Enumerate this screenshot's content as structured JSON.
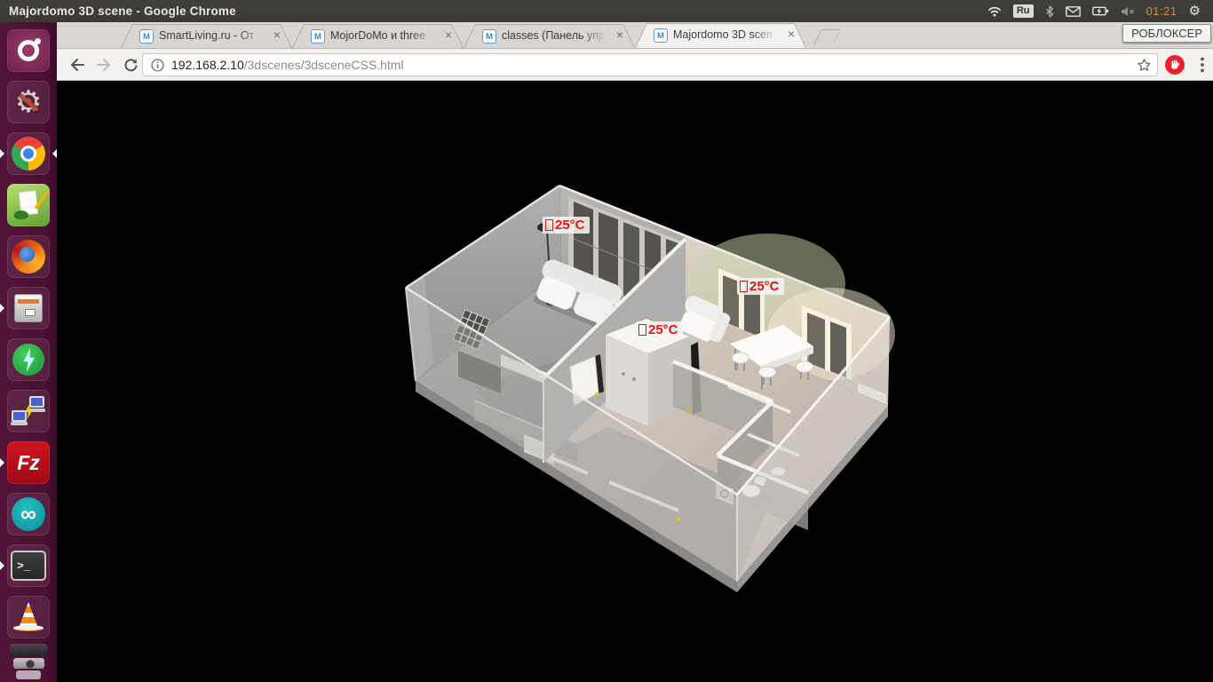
{
  "panel": {
    "window_title": "Majordomo 3D scene - Google Chrome",
    "keyboard_layout": "Ru",
    "clock": "01:21",
    "overlay_badge": "РОБЛОКСЕР",
    "tray_icons": [
      "wifi-icon",
      "keyboard-layout-indicator",
      "bluetooth-icon",
      "mail-icon",
      "battery-charging-icon",
      "volume-muted-icon",
      "clock",
      "session-gear-icon"
    ]
  },
  "launcher": {
    "items": [
      {
        "name": "ubuntu-dash"
      },
      {
        "name": "system-settings"
      },
      {
        "name": "google-chrome",
        "running": true,
        "focused": true
      },
      {
        "name": "notepad-editor"
      },
      {
        "name": "firefox"
      },
      {
        "name": "file-archiver",
        "running": true
      },
      {
        "name": "lightning-app"
      },
      {
        "name": "remote-connection-app"
      },
      {
        "name": "filezilla",
        "glyph": "Fz",
        "running": true
      },
      {
        "name": "arduino-ide",
        "glyph": "∞"
      },
      {
        "name": "terminal",
        "glyph": ">_",
        "running": true
      },
      {
        "name": "vlc"
      },
      {
        "name": "folded-phone-app"
      },
      {
        "name": "folded-camera-app"
      },
      {
        "name": "folded-paper-app"
      }
    ]
  },
  "browser": {
    "close_glyph": "×",
    "tabs": [
      {
        "title": "SmartLiving.ru - От",
        "favicon": "M",
        "active": false
      },
      {
        "title": "MojorDoMo и three",
        "favicon": "M",
        "active": false
      },
      {
        "title": "classes (Панель упр",
        "favicon": "M",
        "active": false
      },
      {
        "title": "Majordomo 3D scen",
        "favicon": "M",
        "active": true
      }
    ],
    "toolbar": {
      "url_host": "192.168.2.10",
      "url_path": "/3dscenes/3dsceneCSS.html"
    }
  },
  "scene": {
    "description": "3D floor plan of apartment with two rooms, hallway and bathroom",
    "temperature_labels": [
      "25°C",
      "25°C",
      "25°C"
    ]
  }
}
